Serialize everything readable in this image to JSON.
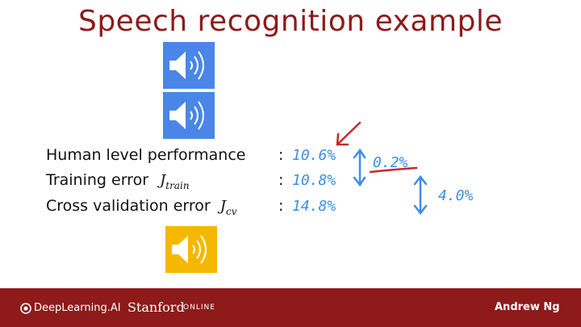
{
  "slide": {
    "title": "Speech recognition example"
  },
  "rows": [
    {
      "label": "Human level performance",
      "symbol": "",
      "subscript": "",
      "value": "10.6%"
    },
    {
      "label": "Training error",
      "symbol": "J",
      "subscript": "train",
      "value": "10.8%"
    },
    {
      "label": "Cross validation error",
      "symbol": "J",
      "subscript": "cv",
      "value": "14.8%"
    }
  ],
  "colon": ":",
  "annotations": {
    "gap_human_train": "0.2%",
    "gap_train_cv": "4.0%"
  },
  "icons": {
    "speaker_top": "speaker-icon",
    "speaker_middle": "speaker-icon",
    "speaker_bottom": "speaker-icon"
  },
  "colors": {
    "title": "#8e1a1a",
    "footer": "#8e1a1a",
    "speaker_blue": "#4a86e8",
    "speaker_yellow": "#f5b800",
    "handwriting_blue": "#3b8ee8",
    "handwriting_red": "#c62828"
  },
  "footer": {
    "brand1": "DeepLearning.AI",
    "brand2": "Stanford",
    "brand2_suffix": "ONLINE",
    "author": "Andrew Ng"
  }
}
